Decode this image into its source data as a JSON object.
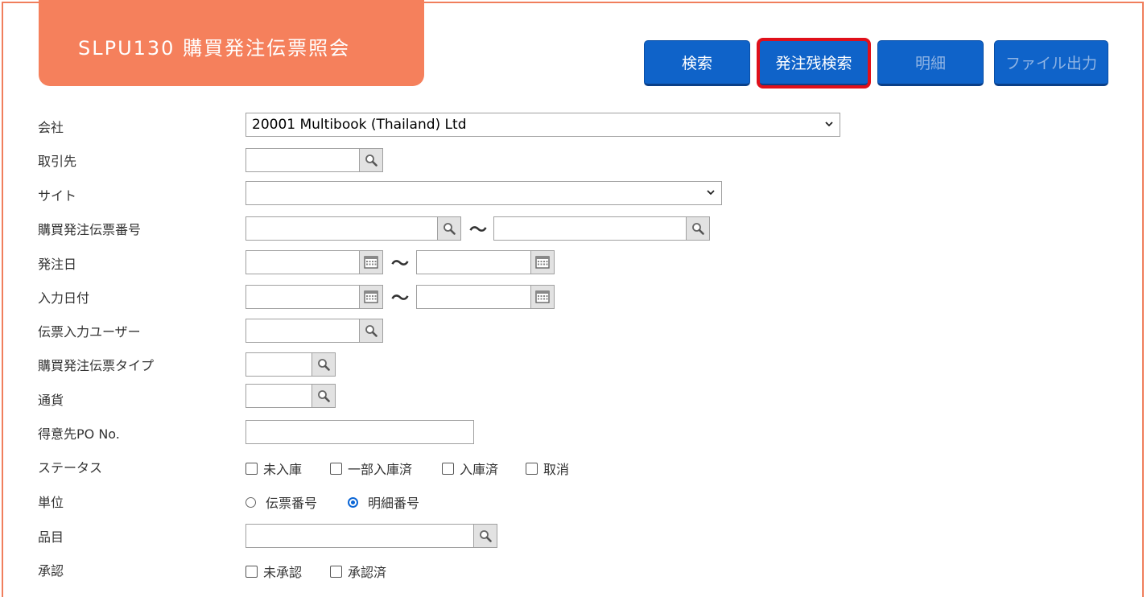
{
  "header": {
    "title": "SLPU130 購買発注伝票照会"
  },
  "toolbar": {
    "search_label": "検索",
    "open_order_search_label": "発注残検索",
    "detail_label": "明細",
    "file_output_label": "ファイル出力"
  },
  "form": {
    "company": {
      "label": "会社",
      "value": "20001 Multibook (Thailand) Ltd"
    },
    "supplier": {
      "label": "取引先",
      "value": ""
    },
    "site": {
      "label": "サイト",
      "value": ""
    },
    "po_number": {
      "label": "購買発注伝票番号",
      "from": "",
      "to": ""
    },
    "order_date": {
      "label": "発注日",
      "from": "",
      "to": ""
    },
    "entry_date": {
      "label": "入力日付",
      "from": "",
      "to": ""
    },
    "entry_user": {
      "label": "伝票入力ユーザー",
      "value": ""
    },
    "po_type": {
      "label": "購買発注伝票タイプ",
      "value": ""
    },
    "currency": {
      "label": "通貨",
      "value": ""
    },
    "customer_po": {
      "label": "得意先PO No.",
      "value": ""
    },
    "status": {
      "label": "ステータス",
      "options": [
        "未入庫",
        "一部入庫済",
        "入庫済",
        "取消"
      ]
    },
    "unit": {
      "label": "単位",
      "options": [
        "伝票番号",
        "明細番号"
      ],
      "selected": "明細番号"
    },
    "item": {
      "label": "品目",
      "value": ""
    },
    "approval": {
      "label": "承認",
      "options": [
        "未承認",
        "承認済"
      ]
    },
    "range_separator": "～"
  },
  "icons": {
    "search": "search-icon",
    "calendar": "calendar-icon",
    "dropdown": "chevron-down-icon"
  },
  "colors": {
    "accent": "#f5805c",
    "button": "#0f63c9",
    "highlight": "#e0101a"
  }
}
